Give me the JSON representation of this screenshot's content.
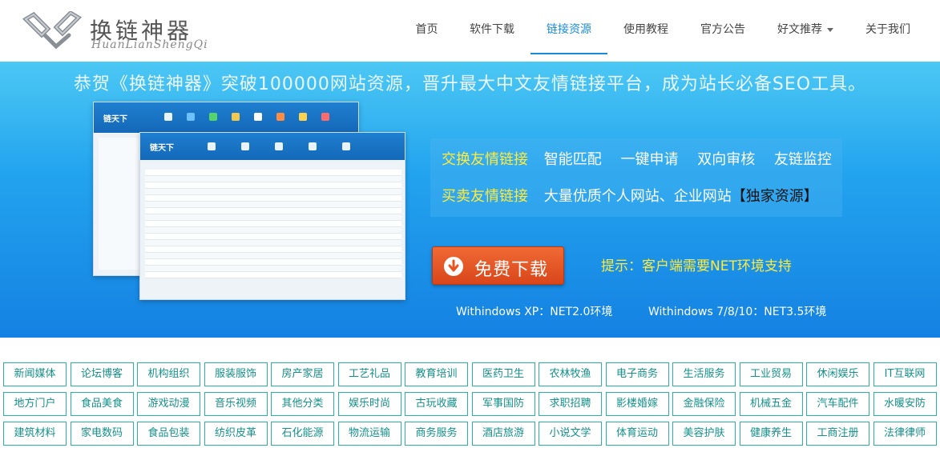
{
  "header": {
    "logo_title": "换链神器",
    "logo_subtitle": "HuanLianShengQi",
    "nav": [
      {
        "label": "首页",
        "active": false,
        "dropdown": false
      },
      {
        "label": "软件下载",
        "active": false,
        "dropdown": false
      },
      {
        "label": "链接资源",
        "active": true,
        "dropdown": false
      },
      {
        "label": "使用教程",
        "active": false,
        "dropdown": false
      },
      {
        "label": "官方公告",
        "active": false,
        "dropdown": false
      },
      {
        "label": "好文推荐",
        "active": false,
        "dropdown": true
      },
      {
        "label": "关于我们",
        "active": false,
        "dropdown": false
      }
    ]
  },
  "banner": {
    "headline": "恭贺《换链神器》突破100000网站资源，晋升最大中文友情链接平台，成为站长必备SEO工具。",
    "screenshot_brand": "链天下",
    "features": {
      "exchange_key": "交换友情链接",
      "exchange_items": [
        "智能匹配",
        "一键申请",
        "双向审核",
        "友链监控"
      ],
      "buy_key": "买卖友情链接",
      "buy_desc": "大量优质个人网站、企业网站",
      "buy_badge": "【独家资源】"
    },
    "download_label": "免费下载",
    "tip": "提示：客户端需要NET环境支持",
    "env_xp": "Withindows XP：NET2.0环境",
    "env_win7": "Withindows 7/8/10：NET3.5环境"
  },
  "categories": [
    "新闻媒体",
    "论坛博客",
    "机构组织",
    "服装服饰",
    "房产家居",
    "工艺礼品",
    "教育培训",
    "医药卫生",
    "农林牧渔",
    "电子商务",
    "生活服务",
    "工业贸易",
    "休闲娱乐",
    "IT互联网",
    "地方门户",
    "食品美食",
    "游戏动漫",
    "音乐视频",
    "其他分类",
    "娱乐时尚",
    "古玩收藏",
    "军事国防",
    "求职招聘",
    "影楼婚嫁",
    "金融保险",
    "机械五金",
    "汽车配件",
    "水暖安防",
    "建筑材料",
    "家电数码",
    "食品包装",
    "纺织皮革",
    "石化能源",
    "物流运输",
    "商务服务",
    "酒店旅游",
    "小说文学",
    "体育运动",
    "美容护肤",
    "健康养生",
    "工商注册",
    "法律律师"
  ],
  "colors": {
    "accent": "#1a8bd6",
    "category_border": "#2ab2a5",
    "category_text": "#14908a",
    "highlight_text": "#ffeb3b",
    "download_button": "#e8551f"
  }
}
